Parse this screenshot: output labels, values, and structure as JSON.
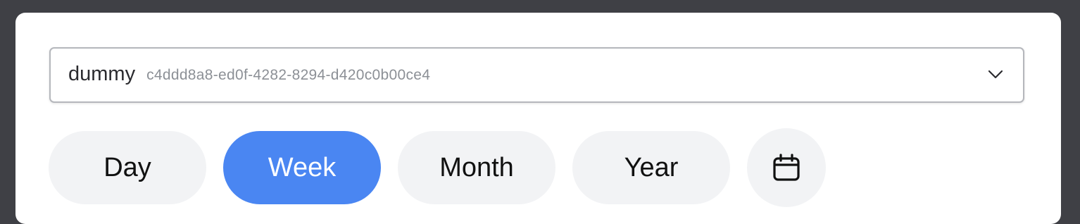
{
  "selector": {
    "name": "dummy",
    "id": "c4ddd8a8-ed0f-4282-8294-d420c0b00ce4",
    "icon": "chevron-down-icon"
  },
  "periods": {
    "day": "Day",
    "week": "Week",
    "month": "Month",
    "year": "Year",
    "selected": "Week",
    "calendar_icon": "calendar-icon"
  },
  "colors": {
    "active": "#4a86f2",
    "inactive": "#f2f3f5",
    "backdrop": "#3f4045"
  }
}
